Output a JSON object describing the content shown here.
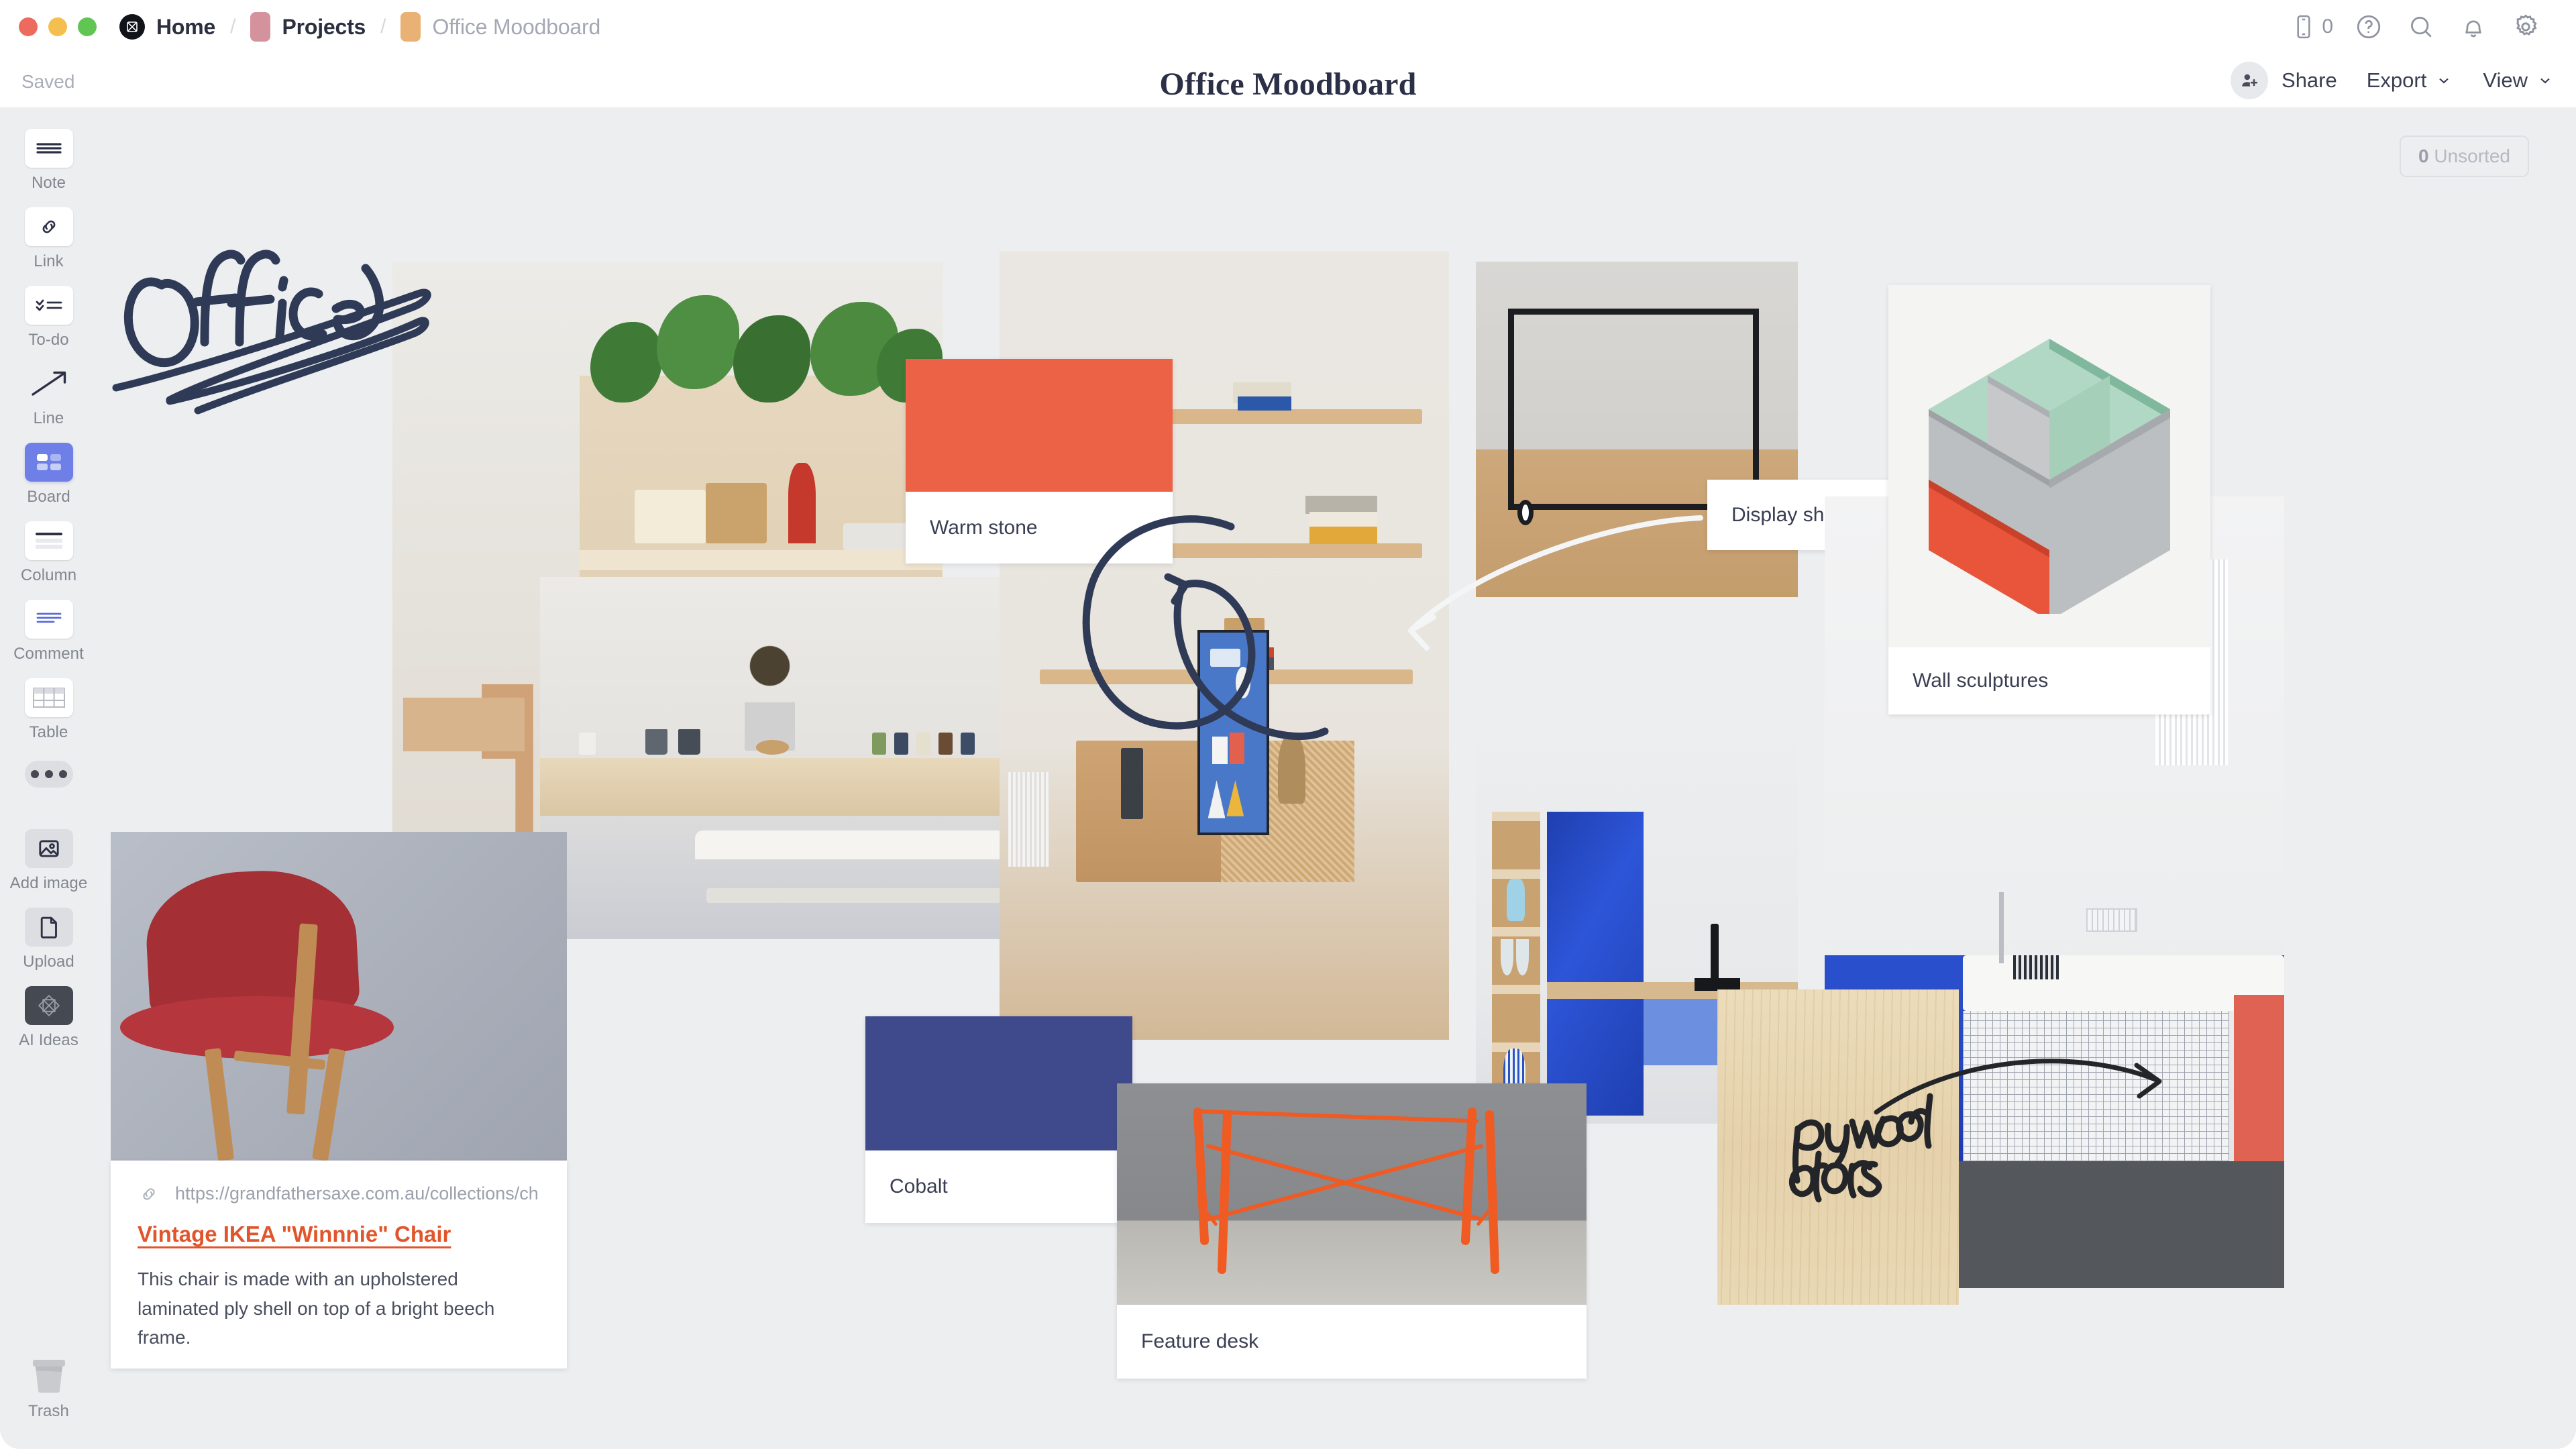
{
  "window": {
    "traffic_lights": [
      "close",
      "minimize",
      "zoom"
    ]
  },
  "breadcrumb": {
    "home": "Home",
    "separator": "/",
    "projects": "Projects",
    "current": "Office Moodboard"
  },
  "topbar": {
    "device_count": "0",
    "icons": [
      "mobile-icon",
      "help-icon",
      "search-icon",
      "notifications-icon",
      "settings-icon"
    ]
  },
  "subbar": {
    "status": "Saved",
    "title": "Office Moodboard",
    "share_label": "Share",
    "export_label": "Export",
    "view_label": "View"
  },
  "sidebar": {
    "items": [
      {
        "label": "Note",
        "icon": "note-icon",
        "state": "default"
      },
      {
        "label": "Link",
        "icon": "link-icon",
        "state": "default"
      },
      {
        "label": "To-do",
        "icon": "todo-icon",
        "state": "default"
      },
      {
        "label": "Line",
        "icon": "line-icon",
        "state": "plain"
      },
      {
        "label": "Board",
        "icon": "board-icon",
        "state": "active"
      },
      {
        "label": "Column",
        "icon": "column-icon",
        "state": "default"
      },
      {
        "label": "Comment",
        "icon": "comment-icon",
        "state": "default"
      },
      {
        "label": "Table",
        "icon": "table-icon",
        "state": "default"
      }
    ],
    "more_label": "More",
    "media": [
      {
        "label": "Add image",
        "icon": "image-icon"
      },
      {
        "label": "Upload",
        "icon": "file-icon"
      },
      {
        "label": "AI Ideas",
        "icon": "ai-icon"
      }
    ],
    "trash_label": "Trash"
  },
  "canvas": {
    "unsorted_count": "0",
    "unsorted_label": "Unsorted",
    "sketch_word": "Office",
    "plywood_note": "plywood doors",
    "cards": [
      {
        "id": "warm-stone",
        "type": "swatch",
        "caption": "Warm stone",
        "color": "#ec6246"
      },
      {
        "id": "cobalt",
        "type": "swatch",
        "caption": "Cobalt",
        "color": "#3f4a8c"
      },
      {
        "id": "display-shelves",
        "type": "label",
        "caption": "Display shelves"
      },
      {
        "id": "wall-sculptures",
        "type": "image",
        "caption": "Wall sculptures"
      },
      {
        "id": "feature-desk",
        "type": "image",
        "caption": "Feature desk"
      }
    ],
    "link_card": {
      "url": "https://grandfathersaxe.com.au/collections/ch",
      "title": "Vintage IKEA \"Winnnie\" Chair",
      "description": "This chair is made with an upholstered laminated ply shell on top of a bright beech frame."
    }
  },
  "colors": {
    "accent_blue": "#6e7fe8",
    "link_orange": "#e0552b",
    "warm_stone": "#ec6246",
    "cobalt": "#3f4a8c",
    "annotation_navy": "#2f3a57",
    "canvas_bg": "#eceef0"
  }
}
